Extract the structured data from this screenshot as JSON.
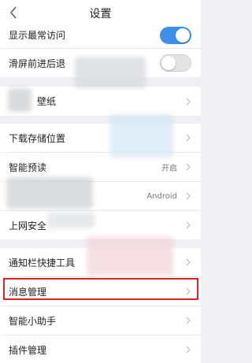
{
  "header": {
    "title": "设置"
  },
  "rows": [
    {
      "label": "显示最常访问",
      "toggle": "on"
    },
    {
      "label": "滑屏前进后退",
      "toggle": "off"
    },
    {
      "label": "壁纸"
    },
    {
      "label": "下载存储位置"
    },
    {
      "label": "智能预读",
      "value": "开启"
    },
    {
      "label": "",
      "value": "Android"
    },
    {
      "label": "上网安全"
    },
    {
      "label": "通知栏快捷工具"
    },
    {
      "label": "消息管理"
    },
    {
      "label": "智能小助手"
    },
    {
      "label": "插件管理"
    }
  ],
  "colors": {
    "accent": "#3d8fe8",
    "highlight": "#d9232a"
  }
}
